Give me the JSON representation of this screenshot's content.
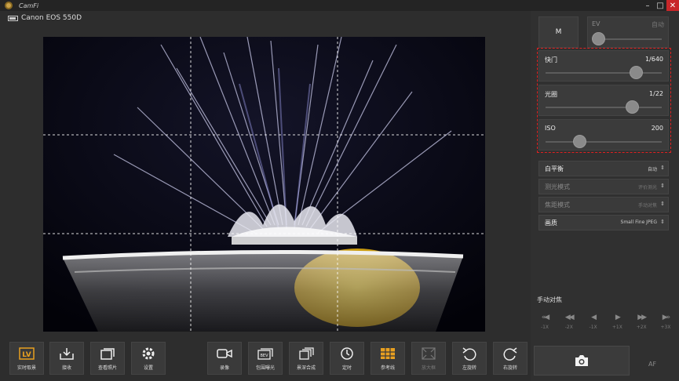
{
  "app": {
    "title": "CamFi"
  },
  "camera": {
    "name": "Canon EOS 550D"
  },
  "window_controls": {
    "minimize": "–",
    "maximize": "□",
    "close": "✕"
  },
  "right_panel": {
    "mode": "M",
    "ev": {
      "label": "EV",
      "value": "自动",
      "level": 0.06
    },
    "sliders": [
      {
        "label": "快门",
        "value": "1/640",
        "level": 0.78
      },
      {
        "label": "光圈",
        "value": "1/22",
        "level": 0.74
      },
      {
        "label": "ISO",
        "value": "200",
        "level": 0.29
      }
    ],
    "options": [
      {
        "label": "白平衡",
        "value": "自动",
        "dim": false
      },
      {
        "label": "测光模式",
        "value": "评价测光",
        "dim": true
      },
      {
        "label": "焦距模式",
        "value": "手动对焦",
        "dim": true
      },
      {
        "label": "画质",
        "value": "Small Fine JPEG",
        "dim": false
      }
    ],
    "manual_focus": {
      "title": "手动对焦",
      "buttons": [
        {
          "icon": "«◀",
          "label": "-1X"
        },
        {
          "icon": "◀◀",
          "label": "-2X"
        },
        {
          "icon": "◀",
          "label": "-1X"
        },
        {
          "icon": "▶",
          "label": "+1X"
        },
        {
          "icon": "▶▶",
          "label": "+2X"
        },
        {
          "icon": "▶»",
          "label": "+3X"
        }
      ]
    },
    "af": "AF"
  },
  "toolbar": {
    "buttons": [
      {
        "label": "实时取景",
        "icon": "live-view-icon"
      },
      {
        "label": "接收",
        "icon": "download-icon"
      },
      {
        "label": "查看照片",
        "icon": "gallery-icon"
      },
      {
        "label": "设置",
        "icon": "gear-icon"
      },
      {
        "label": "录像",
        "icon": "video-icon"
      },
      {
        "label": "包围曝光",
        "icon": "bracket-icon"
      },
      {
        "label": "景深合成",
        "icon": "focus-stack-icon"
      },
      {
        "label": "定时",
        "icon": "timer-icon"
      },
      {
        "label": "参考线",
        "icon": "grid-icon"
      },
      {
        "label": "放大框",
        "icon": "zoom-frame-icon"
      },
      {
        "label": "左旋转",
        "icon": "rotate-left-icon"
      },
      {
        "label": "右旋转",
        "icon": "rotate-right-icon"
      }
    ]
  },
  "colors": {
    "accent": "#e8a020",
    "highlight": "#e02020"
  }
}
